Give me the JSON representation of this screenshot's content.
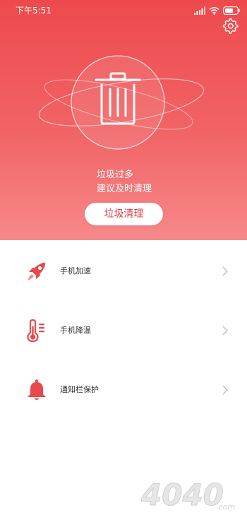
{
  "status": {
    "time": "下午5:51"
  },
  "hero": {
    "line1": "垃圾过多",
    "line2": "建议及时清理",
    "clean_button": "垃圾清理"
  },
  "menu": {
    "items": [
      {
        "label": "手机加速",
        "icon": "rocket-icon"
      },
      {
        "label": "手机降温",
        "icon": "thermometer-icon"
      },
      {
        "label": "通知栏保护",
        "icon": "bell-icon"
      }
    ]
  },
  "watermark": {
    "text": "4040",
    "suffix": ".com"
  },
  "colors": {
    "hero_top": "#ee4a4d",
    "hero_bottom": "#f7898a",
    "accent": "#e8484c",
    "button_text": "#d83f44"
  }
}
